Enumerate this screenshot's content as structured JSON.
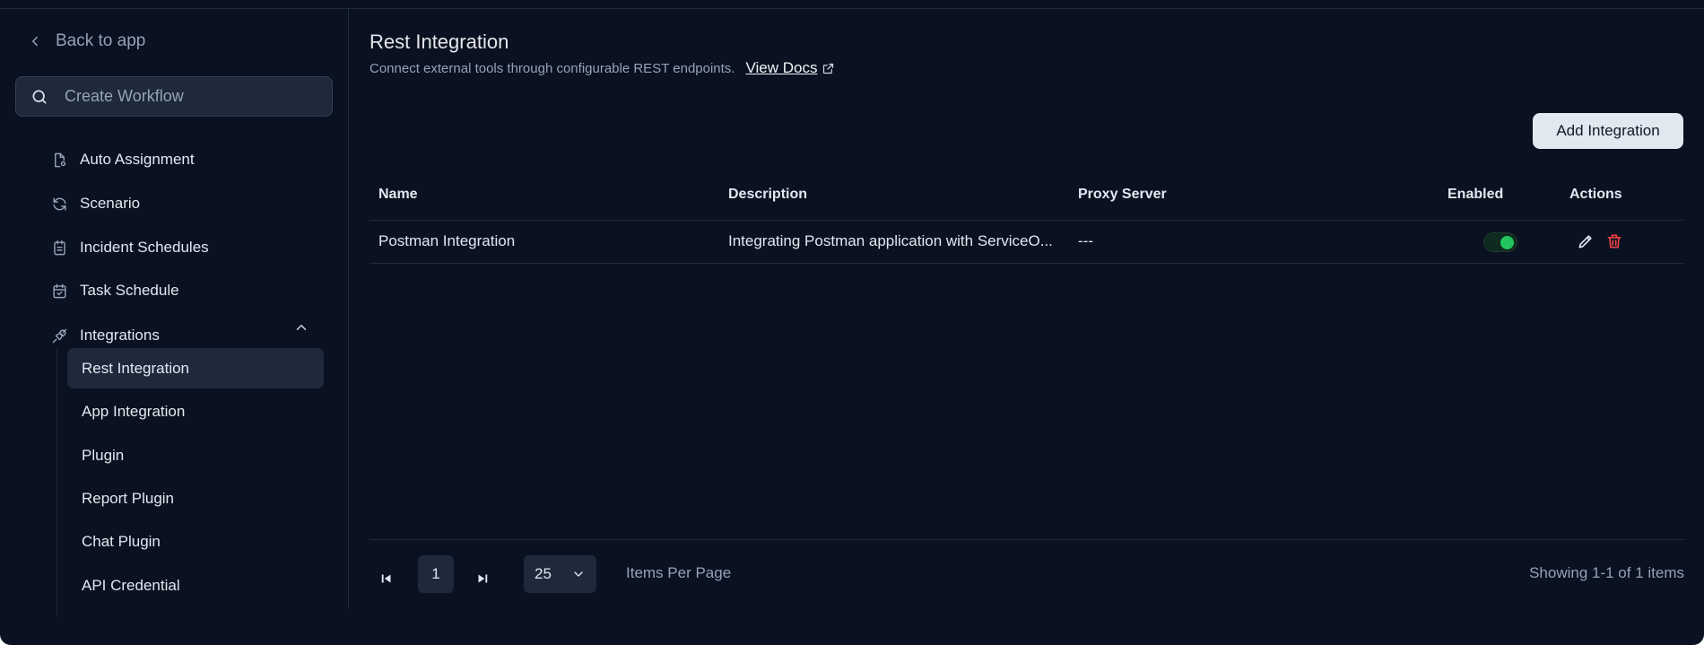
{
  "sidebar": {
    "back_label": "Back to app",
    "search_placeholder": "Create Workflow",
    "items": [
      {
        "label": "Auto Assignment",
        "icon": "file-gear-icon"
      },
      {
        "label": "Scenario",
        "icon": "refresh-icon"
      },
      {
        "label": "Incident Schedules",
        "icon": "clipboard-list-icon"
      },
      {
        "label": "Task Schedule",
        "icon": "calendar-check-icon"
      },
      {
        "label": "Integrations",
        "icon": "plug-icon"
      }
    ],
    "sub_items": [
      {
        "label": "Rest Integration",
        "active": true
      },
      {
        "label": "App Integration"
      },
      {
        "label": "Plugin"
      },
      {
        "label": "Report Plugin"
      },
      {
        "label": "Chat Plugin"
      },
      {
        "label": "API Credential"
      }
    ]
  },
  "header": {
    "title": "Rest Integration",
    "subtitle": "Connect external tools through configurable REST endpoints.",
    "docs_label": "View Docs"
  },
  "toolbar": {
    "add_label": "Add Integration"
  },
  "table": {
    "columns": [
      "Name",
      "Description",
      "Proxy Server",
      "Enabled",
      "Actions"
    ],
    "rows": [
      {
        "name": "Postman Integration",
        "description": "Integrating Postman application with ServiceO...",
        "proxy": "---",
        "enabled": true
      }
    ]
  },
  "pagination": {
    "page": "1",
    "per_page": "25",
    "items_per_page_label": "Items Per Page",
    "showing": "Showing 1-1 of 1 items"
  },
  "colors": {
    "background": "#0a1120",
    "surface": "#1e293b",
    "accent_green": "#22c55e",
    "danger": "#ef4444"
  }
}
